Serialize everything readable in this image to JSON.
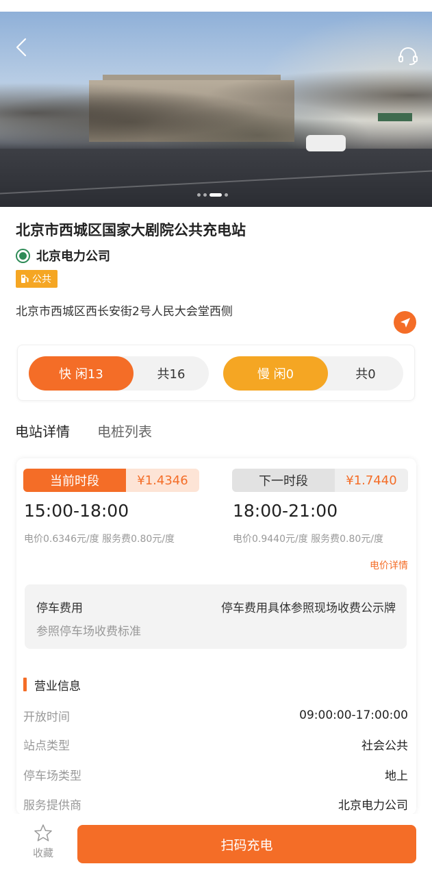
{
  "hero": {
    "back_icon": "chevron-left-icon",
    "service_icon": "headset-icon",
    "carousel_total": 4,
    "carousel_active_index": 2
  },
  "station": {
    "title": "北京市西城区国家大剧院公共充电站",
    "operator": "北京电力公司",
    "tag": "公共",
    "address": "北京市西城区西长安街2号人民大会堂西侧"
  },
  "availability": {
    "fast_label": "快 闲13",
    "fast_total": "共16",
    "slow_label": "慢 闲0",
    "slow_total": "共0"
  },
  "tabs": [
    {
      "label": "电站详情",
      "active": true
    },
    {
      "label": "电桩列表",
      "active": false
    }
  ],
  "pricing": {
    "current": {
      "label": "当前时段",
      "price": "¥1.4346",
      "time": "15:00-18:00",
      "detail": "电价0.6346元/度 服务费0.80元/度"
    },
    "next": {
      "label": "下一时段",
      "price": "¥1.7440",
      "time": "18:00-21:00",
      "detail": "电价0.9440元/度 服务费0.80元/度"
    },
    "detail_link": "电价详情"
  },
  "parking": {
    "label": "停车费用",
    "value": "停车费用具体参照现场收费公示牌",
    "note": "参照停车场收费标准"
  },
  "business": {
    "title": "营业信息",
    "rows": [
      {
        "key": "开放时间",
        "value": "09:00:00-17:00:00"
      },
      {
        "key": "站点类型",
        "value": "社会公共"
      },
      {
        "key": "停车场类型",
        "value": "地上"
      },
      {
        "key": "服务提供商",
        "value": "北京电力公司"
      }
    ]
  },
  "bottom": {
    "favorite_label": "收藏",
    "scan_label": "扫码充电"
  },
  "colors": {
    "accent": "#f46d27",
    "slow": "#f5a623",
    "operator_green": "#2e8b57"
  }
}
